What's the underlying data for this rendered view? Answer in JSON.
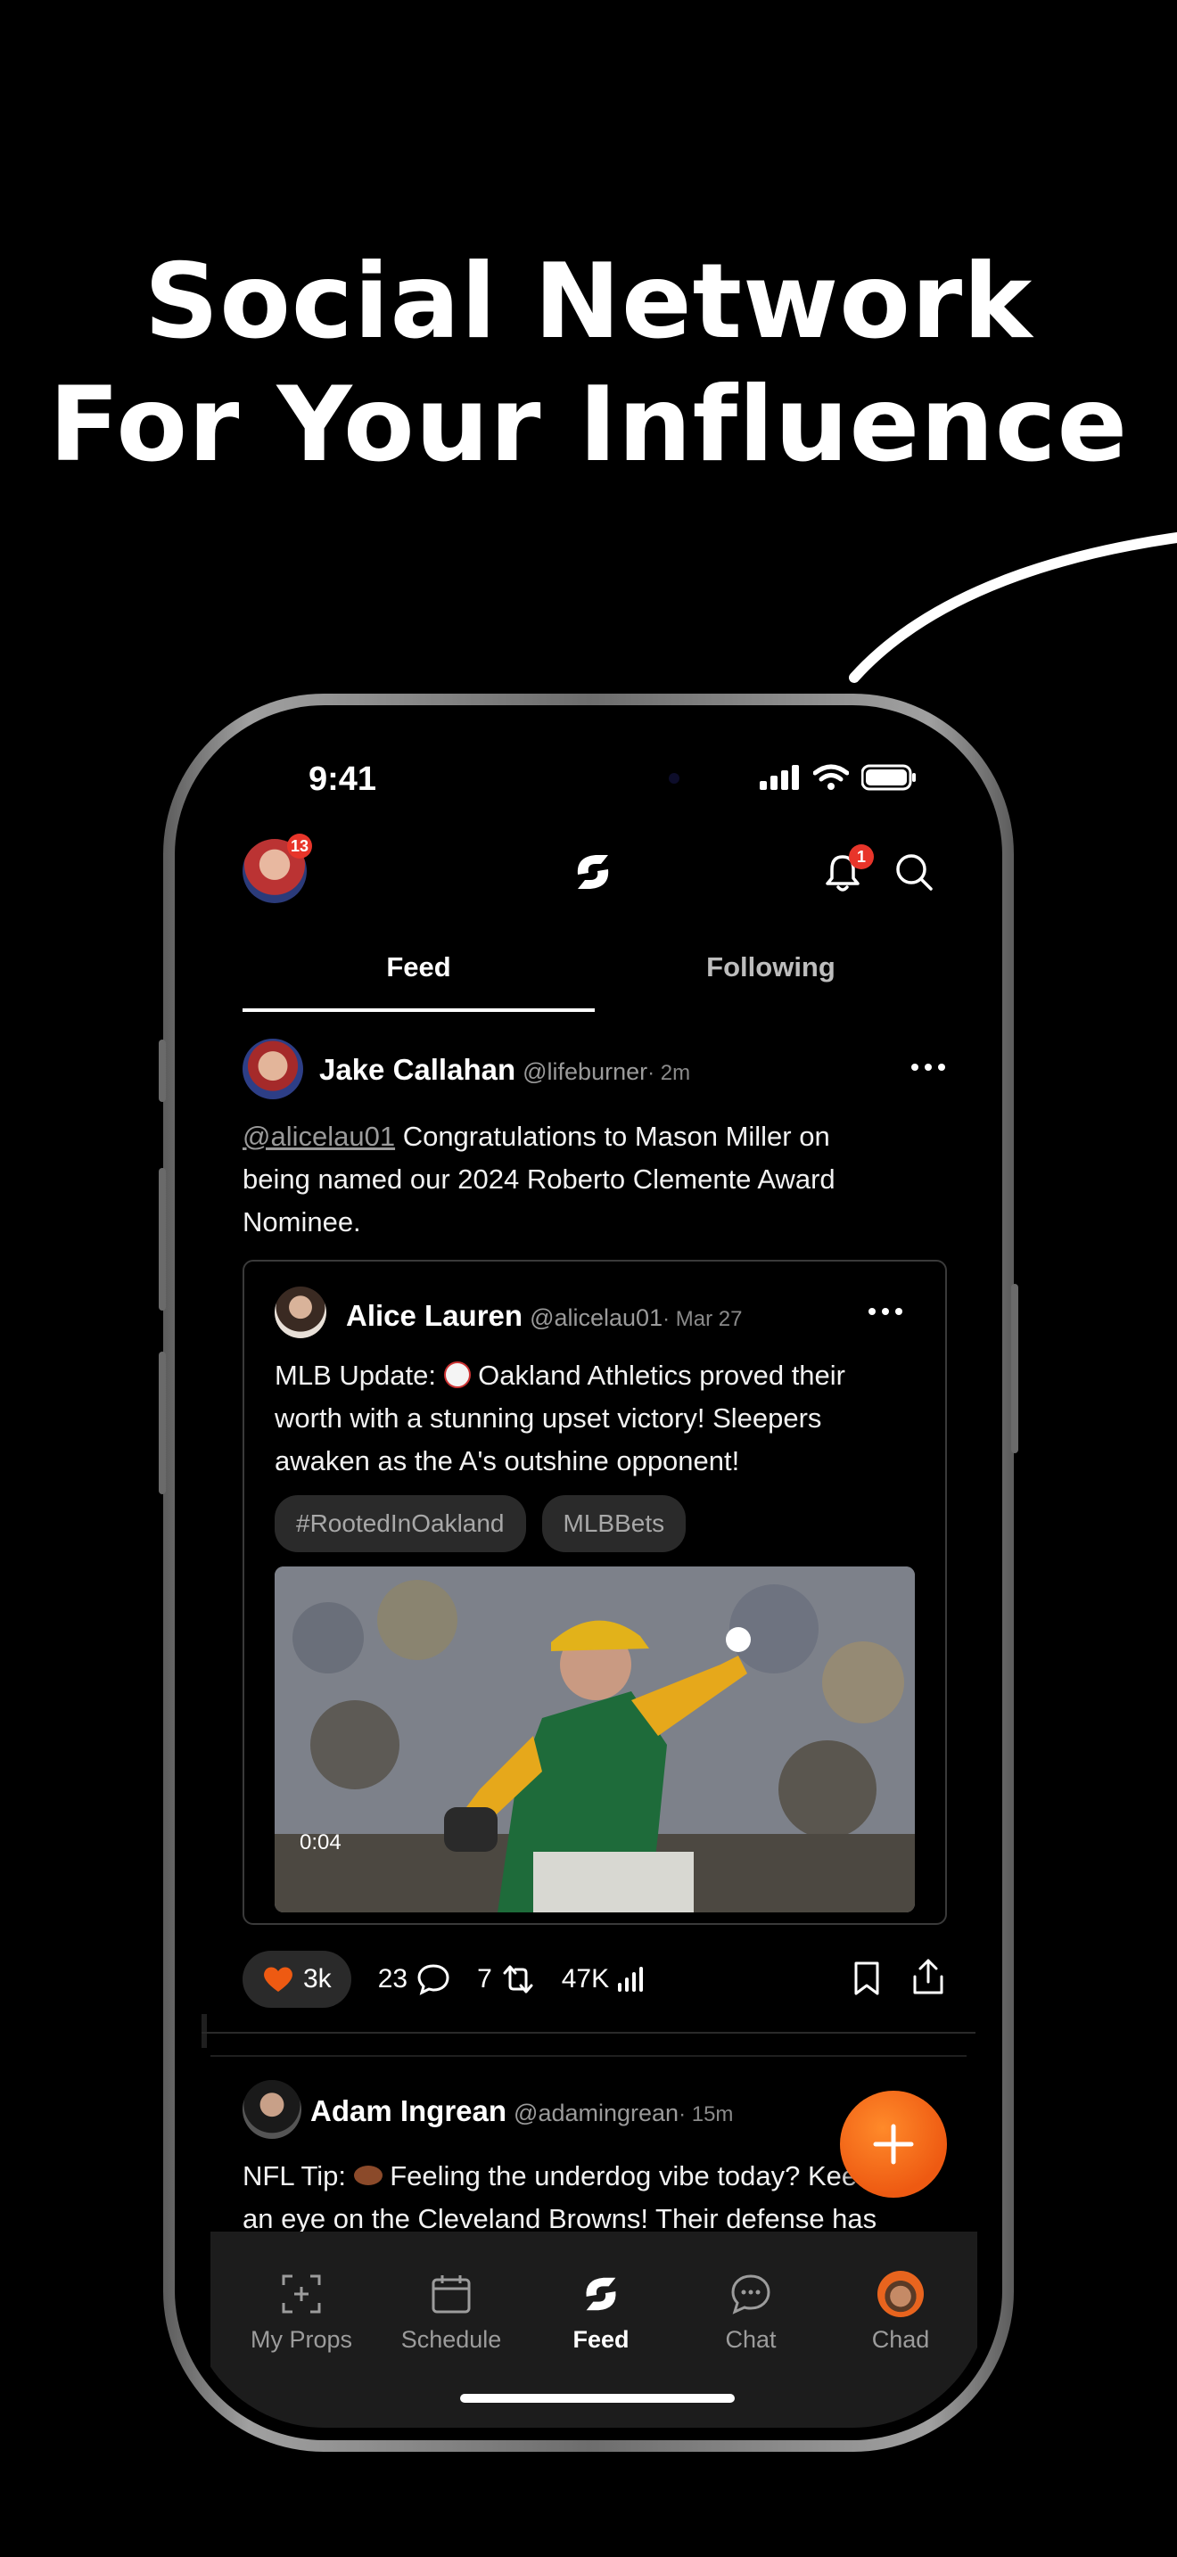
{
  "headline": {
    "line1": "Social Network",
    "line2": "For Your Influence"
  },
  "status_bar": {
    "time": "9:41"
  },
  "header": {
    "avatar_badge": "13",
    "bell_badge": "1"
  },
  "tabs": [
    {
      "label": "Feed",
      "active": true
    },
    {
      "label": "Following",
      "active": false
    }
  ],
  "post1": {
    "name": "Jake Callahan",
    "handle": "@lifeburner",
    "time": "· 2m",
    "mention": "@alicelau01",
    "text_line1": " Congratulations to Mason Miller on",
    "text_line2": "being named our 2024 Roberto Clemente Award",
    "text_line3": "Nominee."
  },
  "quoted": {
    "name": "Alice Lauren",
    "handle": "@alicelau01",
    "time": "· Mar 27",
    "line1a": "MLB Update: ",
    "line1b": " Oakland Athletics proved their",
    "line2": "worth with a stunning upset victory! Sleepers",
    "line3": "awaken as the A's outshine opponent!",
    "tags": [
      "#RootedInOakland",
      "MLBBets"
    ],
    "video_time": "0:04"
  },
  "actions": {
    "likes": "3k",
    "comments": "23",
    "reposts": "7",
    "views": "47K"
  },
  "post2": {
    "name": "Adam Ingrean",
    "handle": "@adamingrean",
    "time": "· 15m",
    "line1a": "NFL Tip: ",
    "line1b": "  Feeling the underdog vibe today? Kee",
    "line2": "an eye on the Cleveland Browns! Their defense has"
  },
  "bottom_nav": [
    {
      "label": "My Props",
      "icon": "add-square-icon",
      "active": false
    },
    {
      "label": "Schedule",
      "icon": "calendar-icon",
      "active": false
    },
    {
      "label": "Feed",
      "icon": "logo-icon",
      "active": true
    },
    {
      "label": "Chat",
      "icon": "chat-bubble-icon",
      "active": false
    },
    {
      "label": "Chad",
      "icon": "profile-avatar",
      "active": false
    }
  ],
  "colors": {
    "accent": "#ee5a12",
    "badge": "#e8352a",
    "background": "#000000"
  }
}
